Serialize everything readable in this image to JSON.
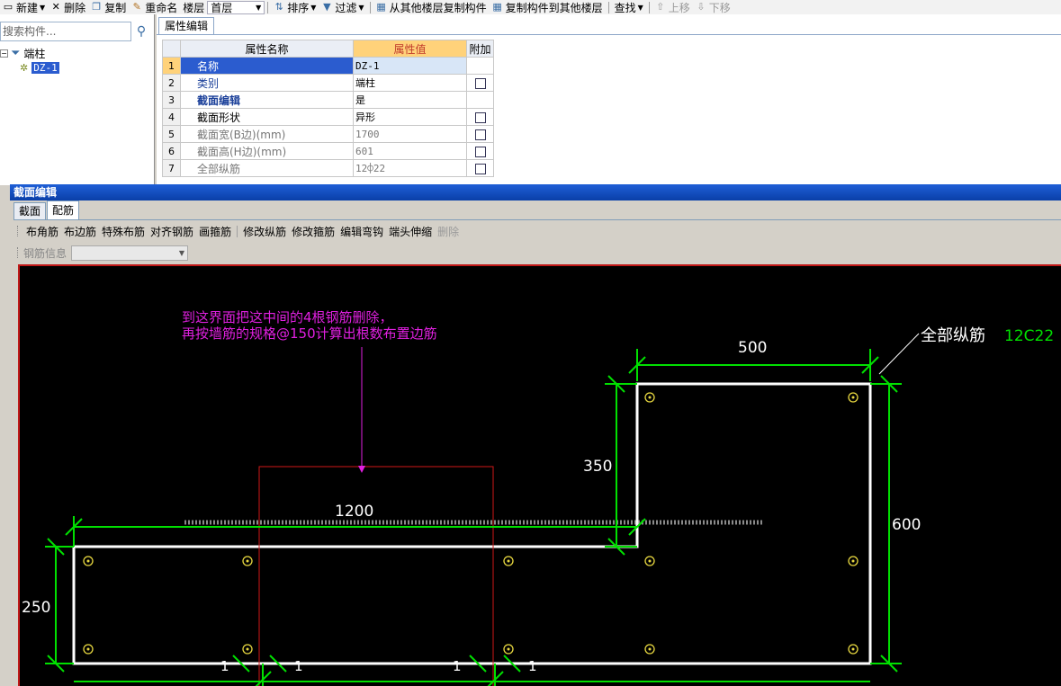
{
  "toolbar": {
    "new": "新建",
    "delete": "删除",
    "copy": "复制",
    "rename": "重命名",
    "floor_label": "楼层",
    "floor_value": "首层",
    "sort": "排序",
    "filter": "过滤",
    "copy_from_other_floor": "从其他楼层复制构件",
    "copy_to_other_floor": "复制构件到其他楼层",
    "find": "查找",
    "move_up": "上移",
    "move_down": "下移"
  },
  "left_panel": {
    "search_placeholder": "搜索构件...",
    "tree_root": "端柱",
    "tree_child": "DZ-1"
  },
  "property_panel": {
    "tab": "属性编辑",
    "headers": {
      "name": "属性名称",
      "value": "属性值",
      "extra": "附加"
    },
    "rows": [
      {
        "idx": "1",
        "name": "名称",
        "value": "DZ-1",
        "has_checkbox": false
      },
      {
        "idx": "2",
        "name": "类别",
        "value": "端柱",
        "has_checkbox": true
      },
      {
        "idx": "3",
        "name": "截面编辑",
        "value": "是",
        "has_checkbox": false
      },
      {
        "idx": "4",
        "name": "截面形状",
        "value": "异形",
        "has_checkbox": true
      },
      {
        "idx": "5",
        "name": "截面宽(B边)(mm)",
        "value": "1700",
        "has_checkbox": true
      },
      {
        "idx": "6",
        "name": "截面高(H边)(mm)",
        "value": "601",
        "has_checkbox": true
      },
      {
        "idx": "7",
        "name": "全部纵筋",
        "value": "12⌽22",
        "has_checkbox": true
      }
    ]
  },
  "section_editor": {
    "title": "截面编辑",
    "tabs": [
      "截面",
      "配筋"
    ],
    "active_tab": "配筋",
    "rebar_tools": [
      "布角筋",
      "布边筋",
      "特殊布筋",
      "对齐钢筋",
      "画箍筋",
      "修改纵筋",
      "修改箍筋",
      "编辑弯钩",
      "端头伸缩",
      "删除"
    ],
    "rebar_info_label": "钢筋信息",
    "canvas": {
      "annotation_line1": "到这界面把这中间的4根钢筋删除，",
      "annotation_line2": "再按墙筋的规格@150计算出根数布置边筋",
      "all_rebar_label": "全部纵筋",
      "all_rebar_value": "12C22",
      "dim_top_width": "500",
      "dim_step_height": "350",
      "dim_left_width": "1200",
      "dim_right_height": "600",
      "dim_left_height": "250",
      "dim_small_1": "1",
      "dim_small_2": "1",
      "dim_small_3": "1",
      "dim_small_4": "1",
      "colors": {
        "outline": "#ffffff",
        "dimension": "#00e000",
        "annotation": "#e020e0",
        "box": "#d01818",
        "rebar": "#e8d840"
      }
    }
  }
}
